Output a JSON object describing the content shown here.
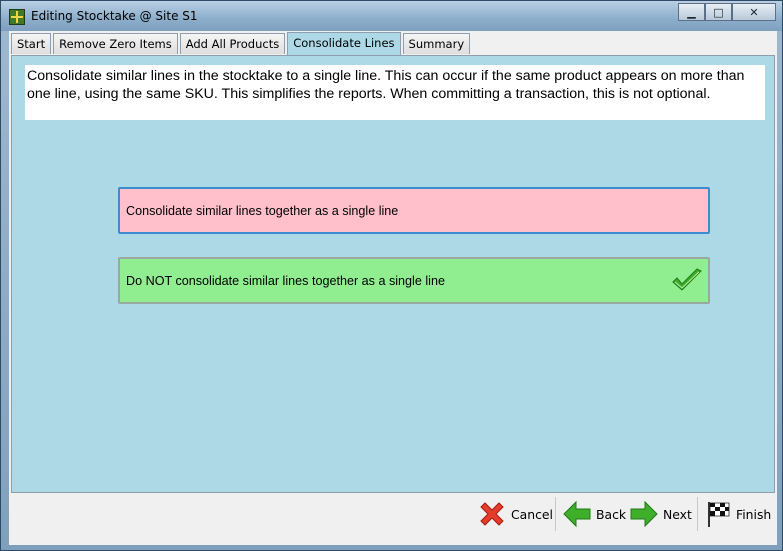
{
  "window": {
    "title": "Editing Stocktake @ Site S1",
    "min_glyph": "▁",
    "max_glyph": "□",
    "close_glyph": "✕"
  },
  "tabs": [
    {
      "label": "Start"
    },
    {
      "label": "Remove Zero Items"
    },
    {
      "label": "Add All Products"
    },
    {
      "label": "Consolidate Lines",
      "active": true
    },
    {
      "label": "Summary"
    }
  ],
  "panel": {
    "description": "Consolidate similar lines in the stocktake to a single line.  This can occur if the same product appears on more than one line, using the same SKU.  This simplifies the reports.  When committing a transaction, this is not optional.",
    "options": [
      {
        "label": "Consolidate similar lines together as a single line",
        "selected": false,
        "color": "#ffc0cb"
      },
      {
        "label": "Do NOT consolidate similar lines together as a single line",
        "selected": true,
        "color": "#90ee90"
      }
    ]
  },
  "footer": {
    "cancel_label": "Cancel",
    "back_label": "Back",
    "next_label": "Next",
    "finish_label": "Finish"
  },
  "colors": {
    "panel_bg": "#add8e6",
    "cancel_icon": "#e53b2a",
    "nav_icon": "#3fae2a"
  }
}
